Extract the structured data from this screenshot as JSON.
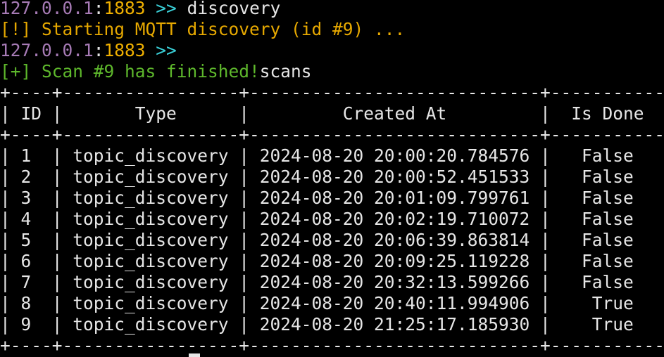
{
  "terminal": {
    "line1": {
      "host": "127.0.0.1",
      "sep": ":",
      "port": "1883",
      "prompt": " >> ",
      "command": "discovery"
    },
    "line2": {
      "text": "[!] Starting MQTT discovery (id #9) ..."
    },
    "line3": {
      "host": "127.0.0.1",
      "sep": ":",
      "port": "1883",
      "prompt": " >>"
    },
    "line4": {
      "status": "[+] Scan #9 has finished!",
      "typed": "scans"
    },
    "table": {
      "border": "+----+-----------------+----------------------------+-----------+",
      "header": "| ID |       Type      |         Created At         |  Is Done  |",
      "rows": [
        "| 1  | topic_discovery | 2024-08-20 20:00:20.784576 |   False   |",
        "| 2  | topic_discovery | 2024-08-20 20:00:52.451533 |   False   |",
        "| 3  | topic_discovery | 2024-08-20 20:01:09.799761 |   False   |",
        "| 4  | topic_discovery | 2024-08-20 20:02:19.710072 |   False   |",
        "| 5  | topic_discovery | 2024-08-20 20:06:39.863814 |   False   |",
        "| 6  | topic_discovery | 2024-08-20 20:09:25.119228 |   False   |",
        "| 7  | topic_discovery | 2024-08-20 20:32:13.599266 |   False   |",
        "| 8  | topic_discovery | 2024-08-20 20:40:11.994906 |    True   |",
        "| 9  | topic_discovery | 2024-08-20 21:25:17.185930 |    True   |"
      ]
    }
  },
  "colors": {
    "background": "#000000",
    "host": "#a77bb6",
    "port": "#f0b000",
    "prompt": "#3ad0d8",
    "warning": "#e6a800",
    "success": "#5eb82c",
    "text": "#e6e6e6"
  }
}
